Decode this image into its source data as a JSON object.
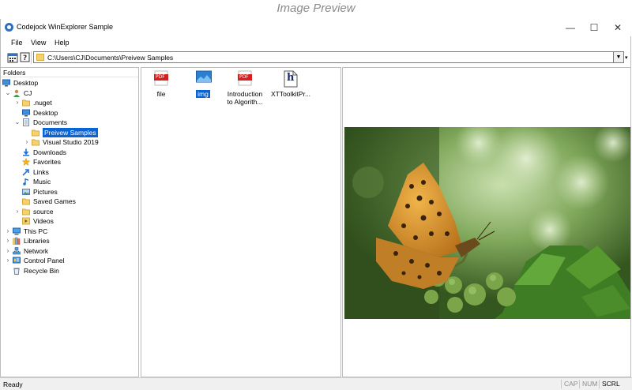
{
  "caption": "Image Preview",
  "window": {
    "title": "Codejock WinExplorer Sample",
    "minimize": "—",
    "maximize": "☐",
    "close": "✕"
  },
  "menu": [
    "File",
    "View",
    "Help"
  ],
  "address": {
    "path": "C:\\Users\\CJ\\Documents\\Preivew Samples"
  },
  "folders": {
    "header": "Folders",
    "items": [
      {
        "label": "Desktop",
        "level": 0,
        "arrow": "",
        "icon": "desktop-icon"
      },
      {
        "label": "CJ",
        "level": 1,
        "arrow": "⌄",
        "icon": "user-icon"
      },
      {
        "label": ".nuget",
        "level": 2,
        "arrow": "›",
        "icon": "folder-icon"
      },
      {
        "label": "Desktop",
        "level": 2,
        "arrow": "",
        "icon": "desktop-icon"
      },
      {
        "label": "Documents",
        "level": 2,
        "arrow": "⌄",
        "icon": "documents-icon"
      },
      {
        "label": "Preivew Samples",
        "level": 3,
        "arrow": "",
        "icon": "folder-icon",
        "selected": true
      },
      {
        "label": "Visual Studio 2019",
        "level": 3,
        "arrow": "›",
        "icon": "folder-icon"
      },
      {
        "label": "Downloads",
        "level": 2,
        "arrow": "",
        "icon": "downloads-icon"
      },
      {
        "label": "Favorites",
        "level": 2,
        "arrow": "",
        "icon": "star-icon"
      },
      {
        "label": "Links",
        "level": 2,
        "arrow": "",
        "icon": "links-icon"
      },
      {
        "label": "Music",
        "level": 2,
        "arrow": "",
        "icon": "music-icon"
      },
      {
        "label": "Pictures",
        "level": 2,
        "arrow": "",
        "icon": "pictures-icon"
      },
      {
        "label": "Saved Games",
        "level": 2,
        "arrow": "",
        "icon": "folder-icon"
      },
      {
        "label": "source",
        "level": 2,
        "arrow": "›",
        "icon": "folder-icon"
      },
      {
        "label": "Videos",
        "level": 2,
        "arrow": "",
        "icon": "videos-icon"
      },
      {
        "label": "This PC",
        "level": 1,
        "arrow": "›",
        "icon": "pc-icon"
      },
      {
        "label": "Libraries",
        "level": 1,
        "arrow": "›",
        "icon": "libraries-icon"
      },
      {
        "label": "Network",
        "level": 1,
        "arrow": "›",
        "icon": "network-icon"
      },
      {
        "label": "Control Panel",
        "level": 1,
        "arrow": "›",
        "icon": "control-panel-icon"
      },
      {
        "label": "Recycle Bin",
        "level": 1,
        "arrow": "",
        "icon": "recycle-bin-icon"
      }
    ]
  },
  "files": [
    {
      "name": "file",
      "icon": "pdf-icon",
      "badge": "PDF",
      "line2": ""
    },
    {
      "name": "img",
      "icon": "image-icon",
      "badge": "",
      "line2": "",
      "selected": true
    },
    {
      "name": "Introduction",
      "line2": "to Algorith...",
      "icon": "pdf-icon",
      "badge": "PDF"
    },
    {
      "name": "XTToolkitPr...",
      "icon": "help-file-icon",
      "badge": "h",
      "line2": ""
    }
  ],
  "status": {
    "text": "Ready",
    "indicators": [
      "CAP",
      "NUM",
      "SCRL"
    ]
  },
  "colors": {
    "selection": "#0a64d4",
    "folder": "#f5d26b",
    "pdf": "#d81e1e"
  }
}
